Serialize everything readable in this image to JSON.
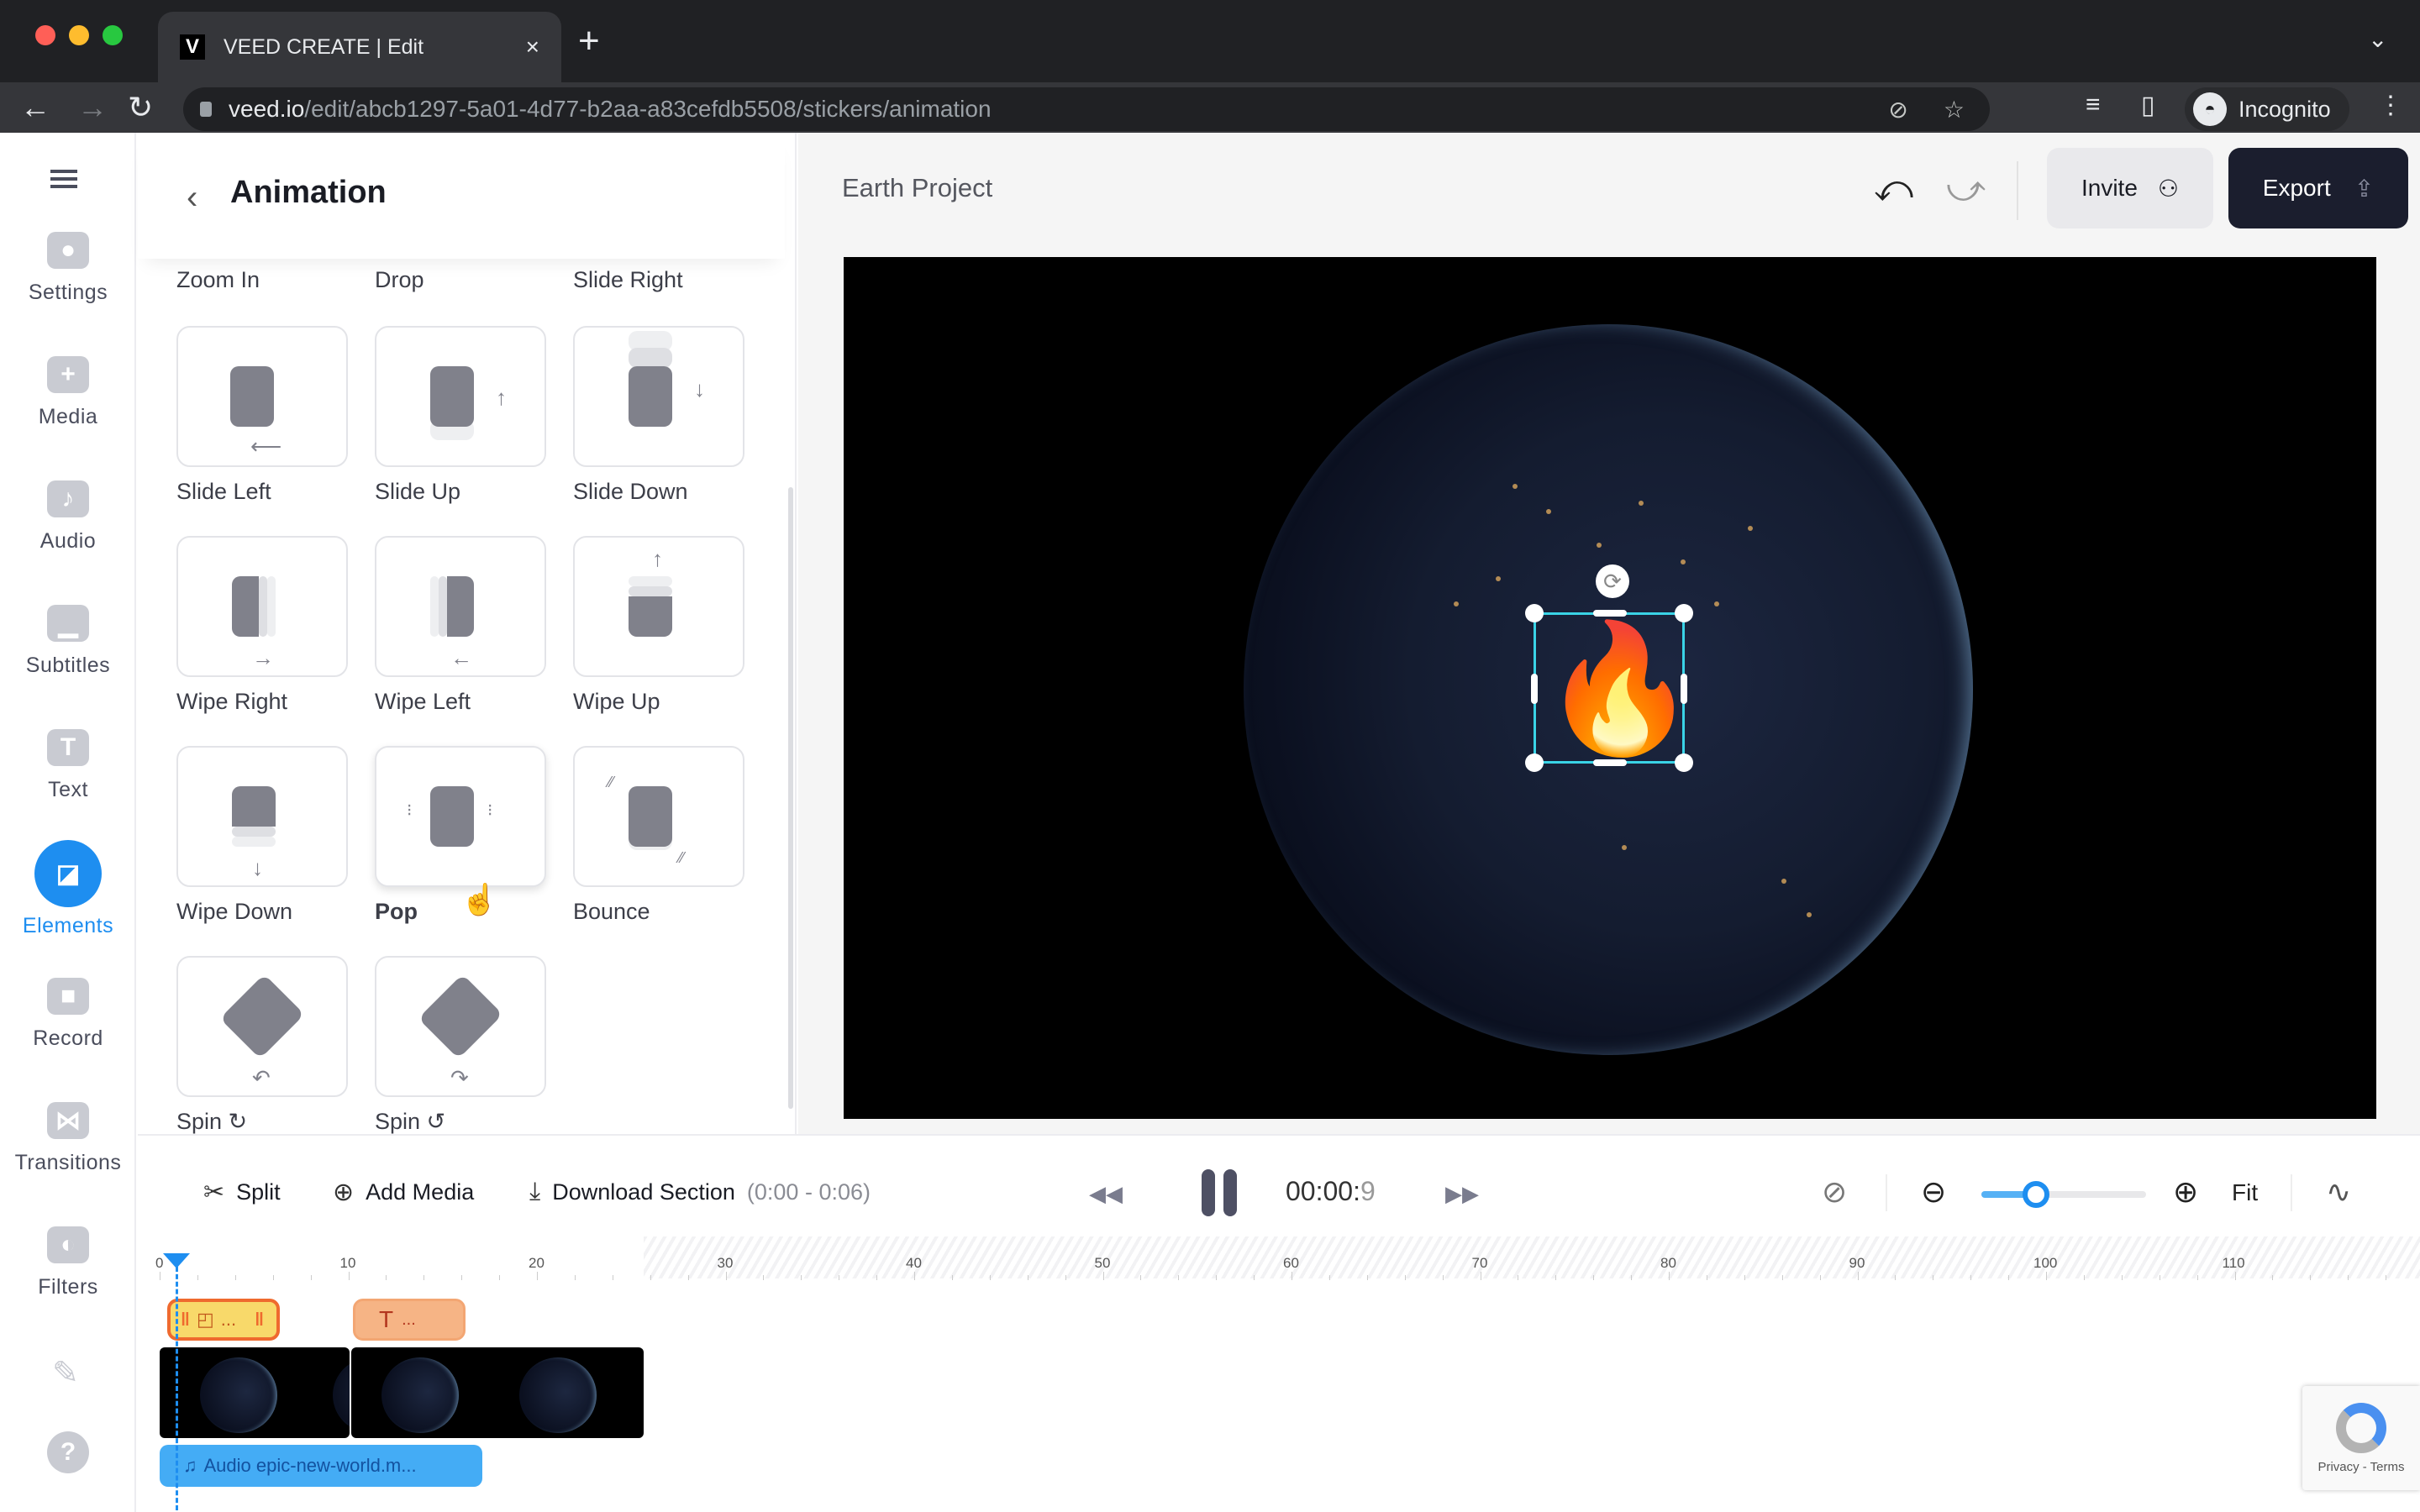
{
  "browser": {
    "tab_title": "VEED CREATE | Edit",
    "tab_favicon": "V",
    "new_tab": "+",
    "url_host": "veed.io",
    "url_path": "/edit/abcb1297-5a01-4d77-b2aa-a83cefdb5508/stickers/animation",
    "profile_label": "Incognito",
    "icons": [
      "back-icon",
      "forward-icon",
      "reload-icon",
      "lock-icon",
      "eye-off-icon",
      "star-icon",
      "media-control-icon",
      "sidepanel-icon",
      "incognito-icon",
      "more-icon",
      "tab-list-chevron-icon"
    ]
  },
  "sidebar": {
    "items": [
      {
        "label": "Settings",
        "icon": "settings-icon",
        "glyph": "●"
      },
      {
        "label": "Media",
        "icon": "plus-icon",
        "glyph": "+"
      },
      {
        "label": "Audio",
        "icon": "music-note-icon",
        "glyph": "♪"
      },
      {
        "label": "Subtitles",
        "icon": "subtitles-icon",
        "glyph": "▁"
      },
      {
        "label": "Text",
        "icon": "text-icon",
        "glyph": "T"
      },
      {
        "label": "Elements",
        "icon": "elements-icon",
        "glyph": "◪",
        "active": true
      },
      {
        "label": "Record",
        "icon": "camera-icon",
        "glyph": "■"
      },
      {
        "label": "Transitions",
        "icon": "transitions-icon",
        "glyph": "⋈"
      },
      {
        "label": "Filters",
        "icon": "filters-icon",
        "glyph": "◐"
      }
    ],
    "extra_icons": [
      "pencil-icon",
      "help-icon"
    ],
    "help_glyph": "?",
    "pencil_glyph": "✎",
    "accent": "#1e8ef0"
  },
  "panel": {
    "title": "Animation",
    "back_glyph": "‹",
    "top_partial_labels": [
      "Zoom In",
      "Drop",
      "Slide Right"
    ],
    "animations": [
      {
        "label": "Slide Left",
        "arrow": "⟵"
      },
      {
        "label": "Slide Up",
        "arrow": "↑"
      },
      {
        "label": "Slide Down",
        "arrow": "↓"
      },
      {
        "label": "Wipe Right",
        "arrow": "→"
      },
      {
        "label": "Wipe Left",
        "arrow": "←"
      },
      {
        "label": "Wipe Up",
        "arrow": "↑"
      },
      {
        "label": "Wipe Down",
        "arrow": "↓"
      },
      {
        "label": "Pop",
        "arrow": "",
        "hovered": true
      },
      {
        "label": "Bounce",
        "arrow": ""
      },
      {
        "label": "Spin ↻",
        "arrow": "↶"
      },
      {
        "label": "Spin ↺",
        "arrow": "↷"
      }
    ]
  },
  "header": {
    "project_title": "Earth Project",
    "undo_glyph": "⤺",
    "redo_glyph": "⤻",
    "invite_label": "Invite",
    "invite_icon_glyph": "⚇",
    "export_label": "Export",
    "export_icon_glyph": "⇪"
  },
  "canvas": {
    "sticker_emoji": "🔥",
    "rotate_glyph": "⟳",
    "selection_color": "#3ad3e6"
  },
  "toolbar": {
    "split_label": "Split",
    "split_glyph": "✂",
    "add_media_label": "Add Media",
    "add_media_glyph": "⊕",
    "download_label": "Download Section",
    "download_range": "(0:00 - 0:06)",
    "download_glyph": "⤓",
    "rewind_glyph": "◀◀",
    "ffwd_glyph": "▶▶",
    "time_main": "00:00:",
    "time_frac": "9",
    "mute_glyph": "⊘",
    "zoom_out_glyph": "⊖",
    "zoom_in_glyph": "⊕",
    "fit_label": "Fit",
    "waveform_glyph": "∿",
    "zoom_level": 0.33
  },
  "timeline": {
    "tick_labels": [
      "0",
      "10",
      "20",
      "30",
      "40",
      "50",
      "60",
      "70",
      "80",
      "90",
      "100",
      "110"
    ],
    "playhead_seconds": 0.9,
    "sticker_clip_label": "...",
    "text_clip_glyph": "T",
    "text_clip_label": "...",
    "audio_clip_label": "Audio epic-new-world.m...",
    "audio_glyph": "♫"
  },
  "recaptcha": {
    "text": "Privacy - Terms"
  }
}
